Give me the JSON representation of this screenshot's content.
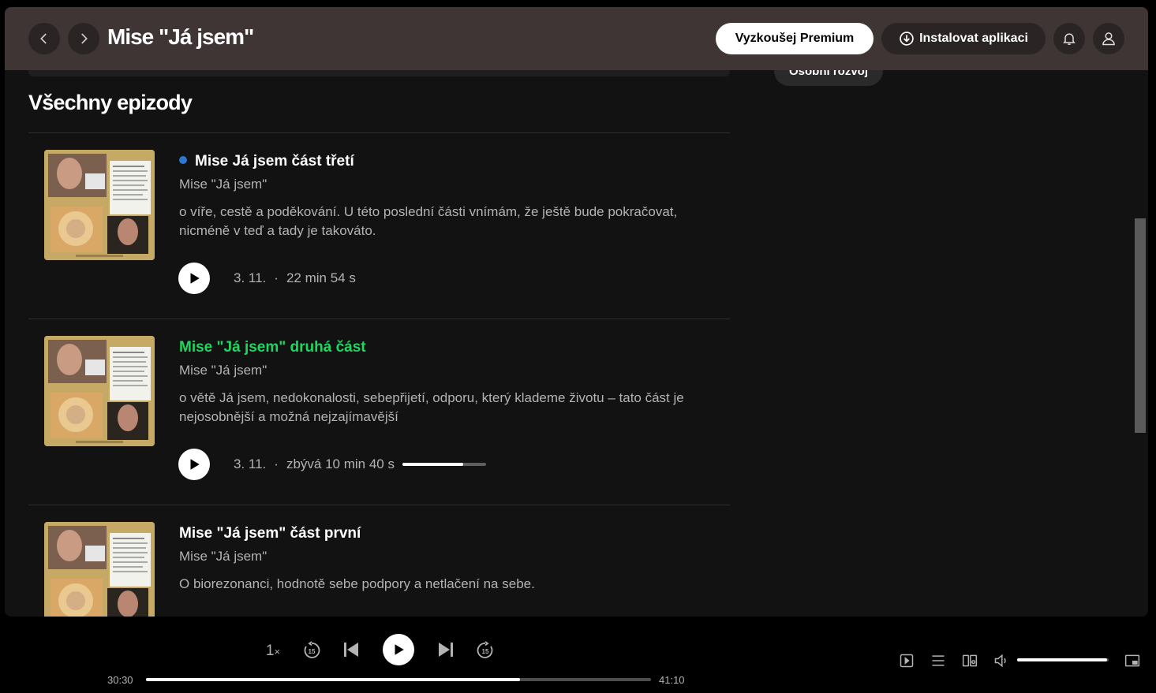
{
  "header": {
    "title": "Mise \"Já jsem\"",
    "premium_label": "Vyzkoušej Premium",
    "install_label": "Instalovat aplikaci"
  },
  "tag_chip": "Osobní rozvoj",
  "section_title": "Všechny epizody",
  "episodes": [
    {
      "title": "Mise Já jsem část třetí",
      "show": "Mise \"Já jsem\"",
      "description": "o víře, cestě a poděkování. U této poslední části vnímám, že ještě bude pokračovat, nicméně v teď a tady je takováto.",
      "date": "3. 11.",
      "duration": "22 min 54 s",
      "unplayed": true
    },
    {
      "title": "Mise \"Já jsem\" druhá část",
      "show": "Mise \"Já jsem\"",
      "description": "o větě Já jsem, nedokonalosti, sebepřijetí, odporu, který klademe životu – tato část je nejosobnější a možná nejzajímavější",
      "date": "3. 11.",
      "duration": "zbývá 10 min 40 s",
      "progress": 0.73,
      "now_playing": true
    },
    {
      "title": "Mise \"Já jsem\" část první",
      "show": "Mise \"Já jsem\"",
      "description": "O biorezonanci, hodnotě sebe podpory a netlačení na sebe."
    }
  ],
  "player": {
    "speed": "1",
    "speed_suffix": "×",
    "skip_back_seconds": "15",
    "skip_forward_seconds": "15",
    "elapsed": "30:30",
    "total": "41:10",
    "progress": 0.74,
    "volume": 0.98
  },
  "colors": {
    "accent_green": "#1ed760",
    "unplayed_dot": "#2e77d0",
    "header_bg": "#3f3535",
    "thumbnail": "#c6a965"
  }
}
